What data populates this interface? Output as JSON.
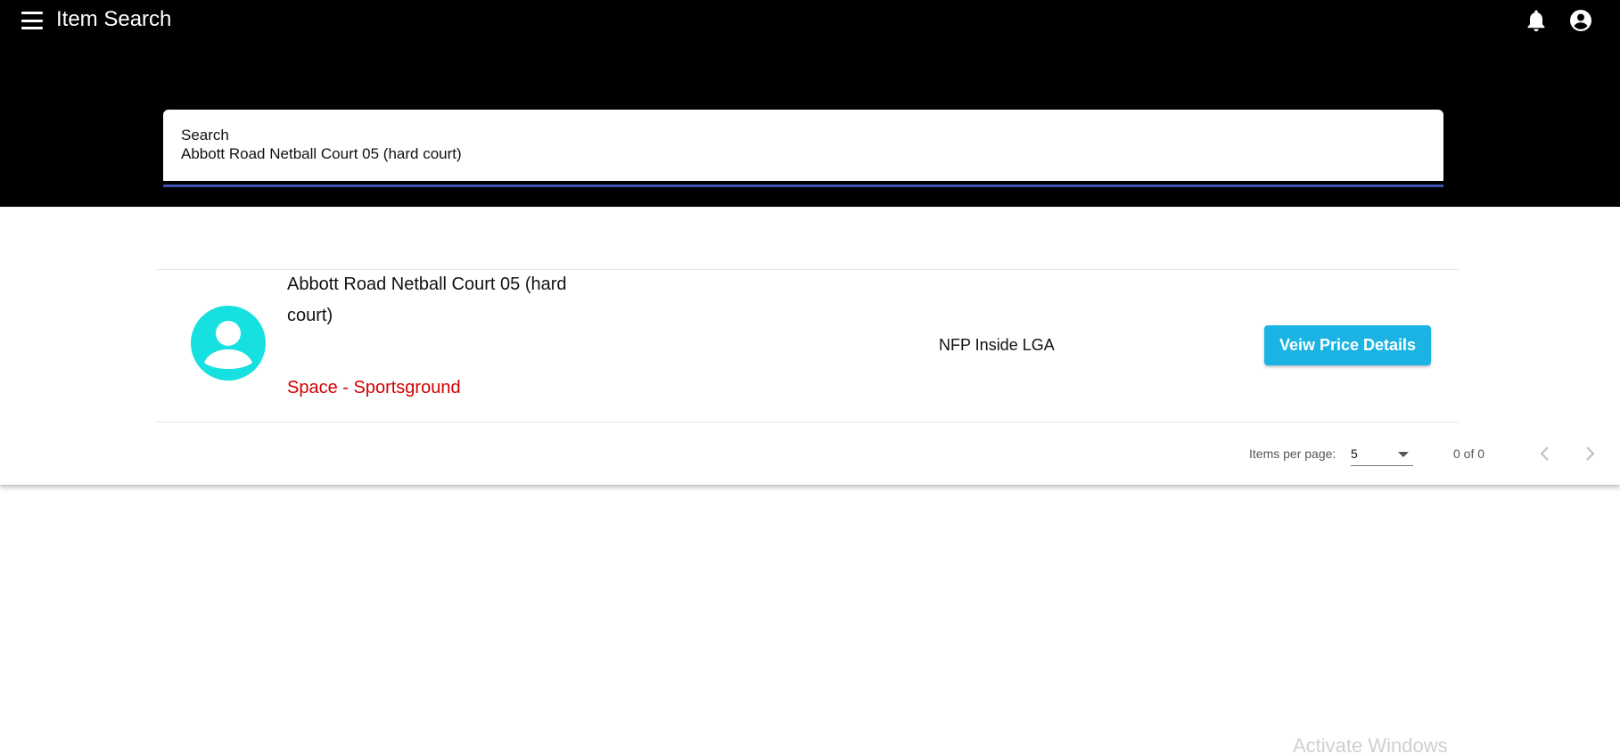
{
  "header": {
    "title": "Item Search",
    "menu_icon": "hamburger-menu-icon",
    "notification_icon": "bell-icon",
    "account_icon": "account-circle-icon"
  },
  "search": {
    "label": "Search",
    "value": "Abbott Road Netball Court 05 (hard court)",
    "underline_color": "#3f51b5"
  },
  "results": [
    {
      "avatar_icon": "person-avatar-icon",
      "avatar_color": "#17e0e0",
      "name": "Abbott Road Netball Court 05 (hard court)",
      "category": "Space - Sportsground",
      "category_color": "#d10000",
      "group": "NFP Inside LGA",
      "action_label": "Veiw Price Details",
      "action_color": "#1ab3e3"
    }
  ],
  "paginator": {
    "items_per_page_label": "Items per page:",
    "items_per_page_value": "5",
    "range_label": "0 of 0",
    "prev_icon": "chevron-left-icon",
    "next_icon": "chevron-right-icon"
  },
  "watermark": "Activate Windows"
}
